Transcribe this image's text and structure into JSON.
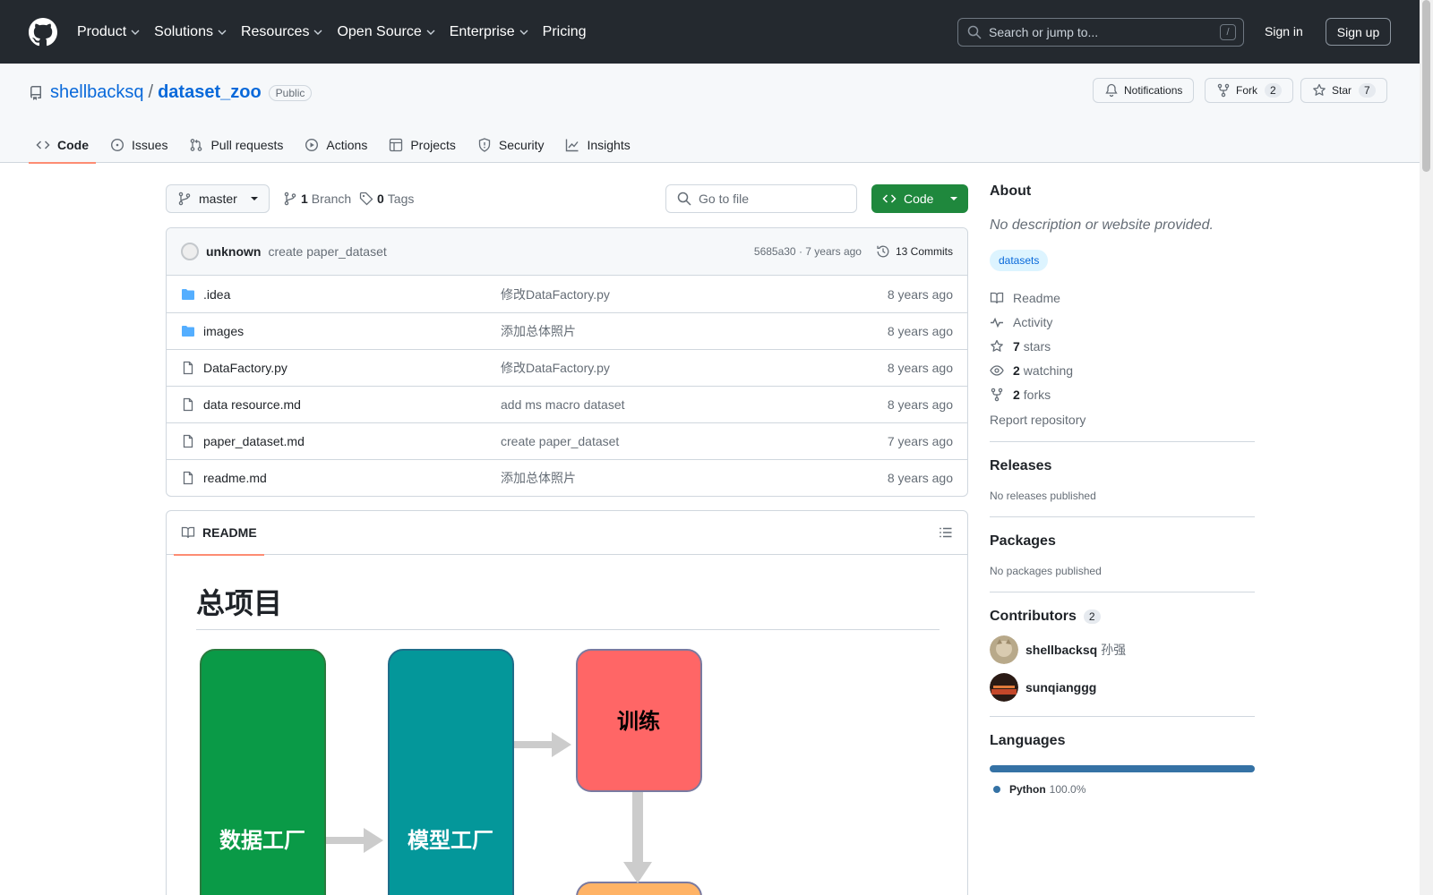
{
  "topnav": {
    "items": [
      {
        "label": "Product",
        "dropdown": true
      },
      {
        "label": "Solutions",
        "dropdown": true
      },
      {
        "label": "Resources",
        "dropdown": true
      },
      {
        "label": "Open Source",
        "dropdown": true
      },
      {
        "label": "Enterprise",
        "dropdown": true
      },
      {
        "label": "Pricing",
        "dropdown": false
      }
    ],
    "search_placeholder": "Search or jump to...",
    "search_shortcut": "/",
    "sign_in": "Sign in",
    "sign_up": "Sign up"
  },
  "repo": {
    "owner": "shellbacksq",
    "separator": "/",
    "name": "dataset_zoo",
    "visibility": "Public",
    "notifications_label": "Notifications",
    "fork_label": "Fork",
    "fork_count": "2",
    "star_label": "Star",
    "star_count": "7",
    "tabs": [
      {
        "label": "Code",
        "icon": "code-icon",
        "active": true
      },
      {
        "label": "Issues",
        "icon": "issue-icon",
        "active": false
      },
      {
        "label": "Pull requests",
        "icon": "pull-request-icon",
        "active": false
      },
      {
        "label": "Actions",
        "icon": "play-icon",
        "active": false
      },
      {
        "label": "Projects",
        "icon": "table-icon",
        "active": false
      },
      {
        "label": "Security",
        "icon": "shield-icon",
        "active": false
      },
      {
        "label": "Insights",
        "icon": "graph-icon",
        "active": false
      }
    ]
  },
  "toolbar": {
    "branch": "master",
    "branch_count": "1",
    "branch_label": "Branch",
    "tag_count": "0",
    "tag_label": "Tags",
    "goto_placeholder": "Go to file",
    "code_label": "Code"
  },
  "commit": {
    "author": "unknown",
    "message": "create paper_dataset",
    "meta": "5685a30 · 7 years ago",
    "count_label": "13 Commits"
  },
  "files": [
    {
      "type": "folder",
      "name": ".idea",
      "message": "修改DataFactory.py",
      "age": "8 years ago"
    },
    {
      "type": "folder",
      "name": "images",
      "message": "添加总体照片",
      "age": "8 years ago"
    },
    {
      "type": "file",
      "name": "DataFactory.py",
      "message": "修改DataFactory.py",
      "age": "8 years ago"
    },
    {
      "type": "file",
      "name": "data resource.md",
      "message": "add ms macro dataset",
      "age": "8 years ago"
    },
    {
      "type": "file",
      "name": "paper_dataset.md",
      "message": "create paper_dataset",
      "age": "7 years ago"
    },
    {
      "type": "file",
      "name": "readme.md",
      "message": "添加总体照片",
      "age": "8 years ago"
    }
  ],
  "readme": {
    "tab_label": "README",
    "heading": "总项目",
    "diagram": {
      "box1": "数据工厂",
      "box2": "模型工厂",
      "box3": "训练",
      "colors": {
        "green": "#0a9a47",
        "teal": "#04979a",
        "red": "#ff6666",
        "orange": "#ffb366",
        "arrow": "#cccccc"
      }
    }
  },
  "sidebar": {
    "about_title": "About",
    "about_desc": "No description or website provided.",
    "topic": "datasets",
    "links": [
      {
        "icon": "book-icon",
        "strong": "",
        "label": "Readme"
      },
      {
        "icon": "pulse-icon",
        "strong": "",
        "label": "Activity"
      },
      {
        "icon": "star-icon",
        "strong": "7",
        "label": "stars"
      },
      {
        "icon": "eye-icon",
        "strong": "2",
        "label": "watching"
      },
      {
        "icon": "fork-icon",
        "strong": "2",
        "label": "forks"
      }
    ],
    "report": "Report repository",
    "releases_title": "Releases",
    "releases_text": "No releases published",
    "packages_title": "Packages",
    "packages_text": "No packages published",
    "contributors_title": "Contributors",
    "contributors_count": "2",
    "contributors": [
      {
        "login": "shellbacksq",
        "name": "孙强"
      },
      {
        "login": "sunqianggg",
        "name": ""
      }
    ],
    "languages_title": "Languages",
    "language": "Python",
    "language_pct": "100.0%",
    "language_color": "#3572A5"
  }
}
